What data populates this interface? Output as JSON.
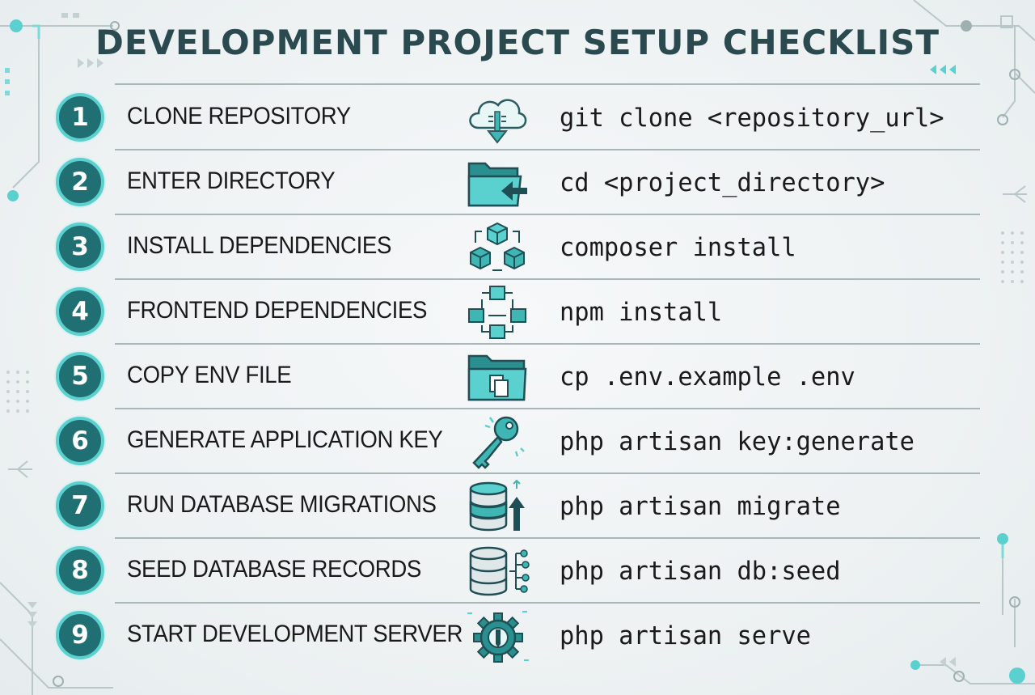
{
  "page": {
    "title": "DEVELOPMENT PROJECT SETUP CHECKLIST"
  },
  "colors": {
    "accent": "#5ad0cf",
    "badge": "#1f6f73",
    "title": "#2b4a50",
    "divider": "#a9b6ba"
  },
  "steps": [
    {
      "number": "1",
      "label": "CLONE REPOSITORY",
      "icon": "cloud-download-icon",
      "command": "git clone <repository_url>"
    },
    {
      "number": "2",
      "label": "ENTER DIRECTORY",
      "icon": "folder-enter-icon",
      "command": "cd <project_directory>"
    },
    {
      "number": "3",
      "label": "INSTALL DEPENDENCIES",
      "icon": "packages-icon",
      "command": "composer install"
    },
    {
      "number": "4",
      "label": "FRONTEND DEPENDENCIES",
      "icon": "module-graph-icon",
      "command": "npm install"
    },
    {
      "number": "5",
      "label": "COPY ENV FILE",
      "icon": "folder-copy-icon",
      "command": "cp .env.example .env"
    },
    {
      "number": "6",
      "label": "GENERATE APPLICATION KEY",
      "icon": "key-icon",
      "command": "php artisan key:generate"
    },
    {
      "number": "7",
      "label": "RUN DATABASE MIGRATIONS",
      "icon": "database-upload-icon",
      "command": "php artisan migrate"
    },
    {
      "number": "8",
      "label": "SEED DATABASE RECORDS",
      "icon": "database-seed-icon",
      "command": "php artisan db:seed"
    },
    {
      "number": "9",
      "label": "START DEVELOPMENT SERVER",
      "icon": "gear-wrench-icon",
      "command": "php artisan serve"
    }
  ]
}
